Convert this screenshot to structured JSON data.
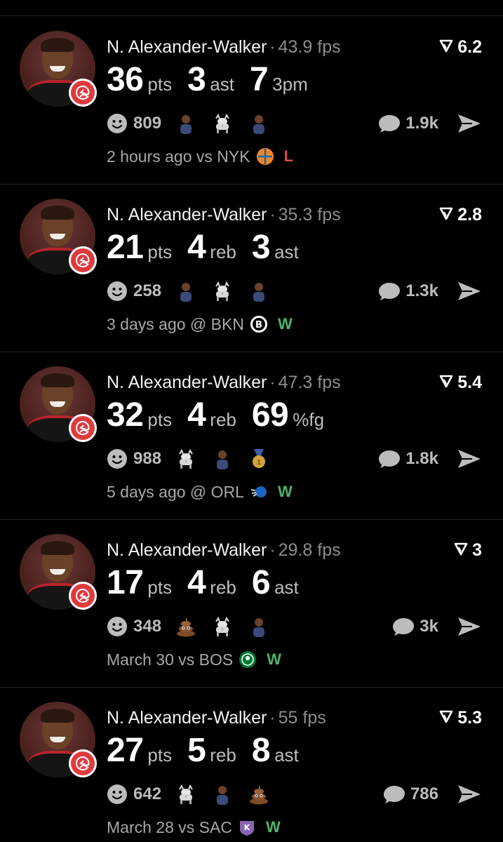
{
  "colors": {
    "win": "#4fb46a",
    "loss": "#e04a4a",
    "team_primary": "#e03a3e"
  },
  "posts": [
    {
      "player": "N. Alexander-Walker",
      "fps": "43.9 fps",
      "score": "6.2",
      "stats": [
        {
          "num": "36",
          "unit": "pts"
        },
        {
          "num": "3",
          "unit": "ast"
        },
        {
          "num": "7",
          "unit": "3pm"
        }
      ],
      "reactions": "809",
      "emojis": [
        "player-icon",
        "goat-icon",
        "player-icon"
      ],
      "comments": "1.9k",
      "when": "2 hours ago",
      "vs": "vs NYK",
      "opponent_logo": "knicks-logo-icon",
      "result": "L"
    },
    {
      "player": "N. Alexander-Walker",
      "fps": "35.3 fps",
      "score": "2.8",
      "stats": [
        {
          "num": "21",
          "unit": "pts"
        },
        {
          "num": "4",
          "unit": "reb"
        },
        {
          "num": "3",
          "unit": "ast"
        }
      ],
      "reactions": "258",
      "emojis": [
        "player-icon",
        "goat-icon",
        "player-icon"
      ],
      "comments": "1.3k",
      "when": "3 days ago",
      "vs": "@ BKN",
      "opponent_logo": "nets-logo-icon",
      "result": "W"
    },
    {
      "player": "N. Alexander-Walker",
      "fps": "47.3 fps",
      "score": "5.4",
      "stats": [
        {
          "num": "32",
          "unit": "pts"
        },
        {
          "num": "4",
          "unit": "reb"
        },
        {
          "num": "69",
          "unit": "%fg"
        }
      ],
      "reactions": "988",
      "emojis": [
        "goat-icon",
        "player-icon",
        "medal-icon"
      ],
      "comments": "1.8k",
      "when": "5 days ago",
      "vs": "@ ORL",
      "opponent_logo": "magic-logo-icon",
      "result": "W"
    },
    {
      "player": "N. Alexander-Walker",
      "fps": "29.8 fps",
      "score": "3",
      "stats": [
        {
          "num": "17",
          "unit": "pts"
        },
        {
          "num": "4",
          "unit": "reb"
        },
        {
          "num": "6",
          "unit": "ast"
        }
      ],
      "reactions": "348",
      "emojis": [
        "poop-icon",
        "goat-icon",
        "player-icon"
      ],
      "comments": "3k",
      "when": "March 30",
      "vs": "vs BOS",
      "opponent_logo": "celtics-logo-icon",
      "result": "W"
    },
    {
      "player": "N. Alexander-Walker",
      "fps": "55 fps",
      "score": "5.3",
      "stats": [
        {
          "num": "27",
          "unit": "pts"
        },
        {
          "num": "5",
          "unit": "reb"
        },
        {
          "num": "8",
          "unit": "ast"
        }
      ],
      "reactions": "642",
      "emojis": [
        "goat-icon",
        "player-icon",
        "poop-icon"
      ],
      "comments": "786",
      "when": "March 28",
      "vs": "vs SAC",
      "opponent_logo": "kings-logo-icon",
      "result": "W"
    }
  ]
}
